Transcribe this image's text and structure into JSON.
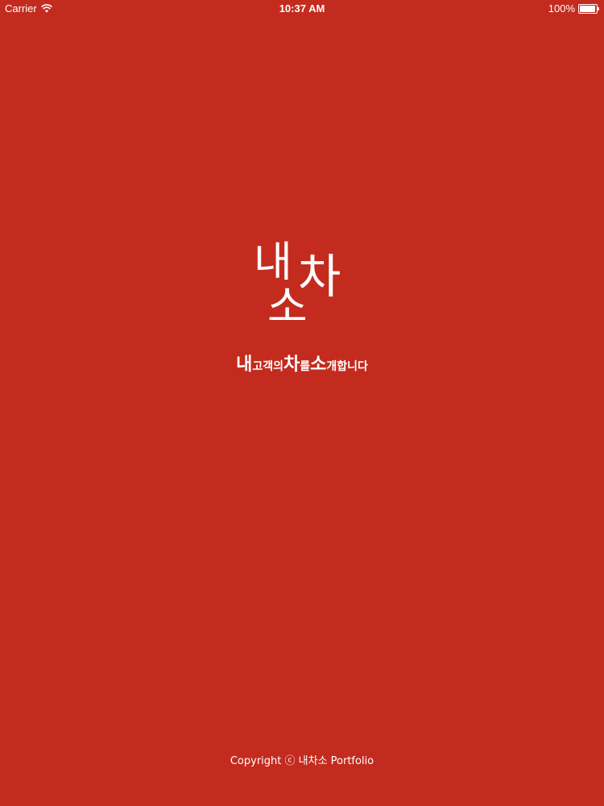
{
  "status_bar": {
    "carrier": "Carrier",
    "time": "10:37 AM",
    "battery": "100%",
    "battery_level": 1.0
  },
  "logo": {
    "char1": "내",
    "char2": "차",
    "char3": "소"
  },
  "tagline": {
    "parts": [
      {
        "text": "내",
        "size": "big"
      },
      {
        "text": "고객의",
        "size": "small"
      },
      {
        "text": "차",
        "size": "big"
      },
      {
        "text": "를",
        "size": "small"
      },
      {
        "text": "소",
        "size": "big"
      },
      {
        "text": "개합니다",
        "size": "small"
      }
    ]
  },
  "footer": {
    "copyright": "Copyright ⓒ 내차소 Portfolio"
  },
  "colors": {
    "background": "#C42B1F",
    "text": "#FFFFFF"
  },
  "icons": {
    "wifi": "wifi-icon",
    "battery": "battery-icon"
  }
}
